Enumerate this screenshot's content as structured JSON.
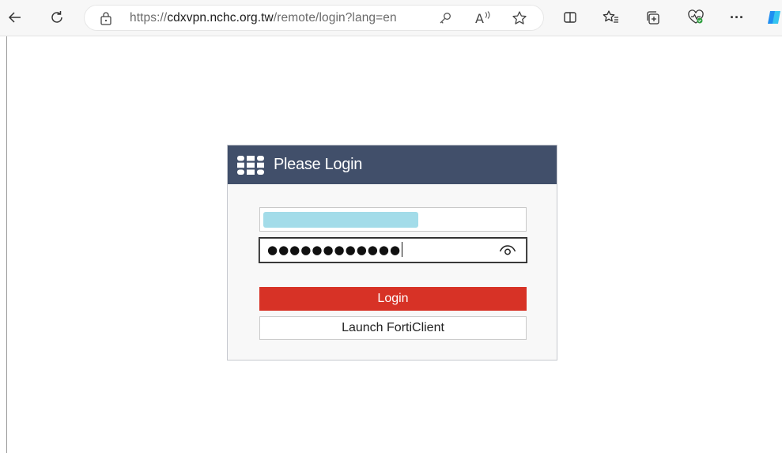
{
  "browser": {
    "url_scheme": "https://",
    "url_host": "cdxvpn.nchc.org.tw",
    "url_path": "/remote/login?lang=en",
    "read_aloud_label": "A",
    "more_label": "···"
  },
  "dialog": {
    "title": "Please Login",
    "username_value": "",
    "password_mask": "●●●●●●●●●●●●",
    "login_label": "Login",
    "forticlient_label": "Launch FortiClient"
  },
  "colors": {
    "header": "#414f6a",
    "login_button": "#d73226",
    "username_highlight": "#a3dce9"
  }
}
